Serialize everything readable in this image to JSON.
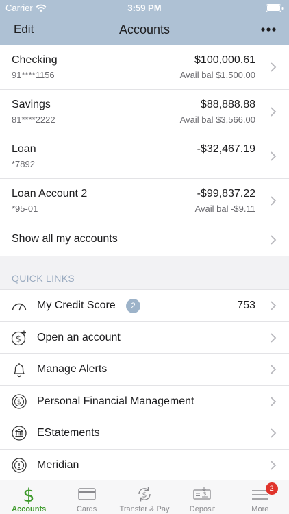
{
  "status_bar": {
    "carrier": "Carrier",
    "time": "3:59 PM"
  },
  "nav": {
    "edit": "Edit",
    "title": "Accounts"
  },
  "accounts": [
    {
      "name": "Checking",
      "number": "91****1156",
      "balance": "$100,000.61",
      "avail": "Avail bal $1,500.00"
    },
    {
      "name": "Savings",
      "number": "81****2222",
      "balance": "$88,888.88",
      "avail": "Avail bal $3,566.00"
    },
    {
      "name": "Loan",
      "number": "*7892",
      "balance": "-$32,467.19",
      "avail": ""
    },
    {
      "name": "Loan Account 2",
      "number": "*95-01",
      "balance": "-$99,837.22",
      "avail": "Avail bal -$9.11"
    }
  ],
  "show_all": "Show all my accounts",
  "quick_links": {
    "header": "QUICK LINKS",
    "items": [
      {
        "label": "My Credit Score",
        "badge": "2",
        "value": "753",
        "icon": "gauge-icon"
      },
      {
        "label": "Open an account",
        "icon": "dollar-plus-icon"
      },
      {
        "label": "Manage Alerts",
        "icon": "bell-icon"
      },
      {
        "label": "Personal Financial Management",
        "icon": "dollar-circle-icon"
      },
      {
        "label": "EStatements",
        "icon": "bank-icon"
      },
      {
        "label": "Meridian",
        "icon": "exclamation-circle-icon"
      }
    ]
  },
  "tabs": [
    {
      "label": "Accounts",
      "active": true,
      "icon": "dollar-icon"
    },
    {
      "label": "Cards",
      "icon": "card-icon"
    },
    {
      "label": "Transfer & Pay",
      "icon": "transfer-icon"
    },
    {
      "label": "Deposit",
      "icon": "check-deposit-icon"
    },
    {
      "label": "More",
      "badge": "2",
      "icon": "menu-icon"
    }
  ],
  "colors": {
    "header": "#aec1d4",
    "active_tab": "#3e9a2c",
    "badge": "#e0332b",
    "quick_links_header": "#9aabc0"
  }
}
